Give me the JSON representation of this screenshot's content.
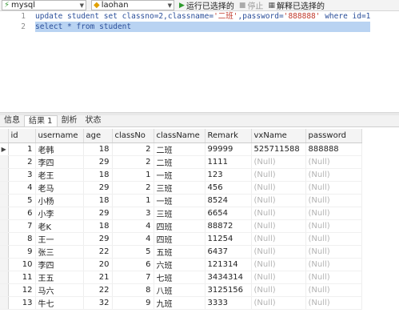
{
  "toolbar": {
    "connection": "mysql",
    "database": "laohan",
    "run_label": "运行已选择的",
    "stop_label": "停止",
    "explain_label": "解释已选择的"
  },
  "editor": {
    "lines": [
      {
        "number": "1",
        "pre": "update student set classno=2,classname=",
        "str1": "'二班'",
        "mid": ",password=",
        "str2": "'888888'",
        "post": " where id=1"
      },
      {
        "number": "2",
        "text": "select * from student"
      }
    ]
  },
  "tabs": [
    "信息",
    "结果 1",
    "剖析",
    "状态"
  ],
  "table": {
    "columns": [
      "id",
      "username",
      "age",
      "classNo",
      "className",
      "Remark",
      "vxName",
      "password"
    ],
    "rows": [
      [
        "1",
        "老韩",
        "18",
        "2",
        "二班",
        "99999",
        "525711588",
        "888888"
      ],
      [
        "2",
        "李四",
        "29",
        "2",
        "二班",
        "1111",
        "(Null)",
        "(Null)"
      ],
      [
        "3",
        "老王",
        "18",
        "1",
        "一班",
        "123",
        "(Null)",
        "(Null)"
      ],
      [
        "4",
        "老马",
        "29",
        "2",
        "三班",
        "456",
        "(Null)",
        "(Null)"
      ],
      [
        "5",
        "小杨",
        "18",
        "1",
        "一班",
        "8524",
        "(Null)",
        "(Null)"
      ],
      [
        "6",
        "小李",
        "29",
        "3",
        "三班",
        "6654",
        "(Null)",
        "(Null)"
      ],
      [
        "7",
        "老K",
        "18",
        "4",
        "四班",
        "88872",
        "(Null)",
        "(Null)"
      ],
      [
        "8",
        "王一",
        "29",
        "4",
        "四班",
        "11254",
        "(Null)",
        "(Null)"
      ],
      [
        "9",
        "张三",
        "22",
        "5",
        "五班",
        "6437",
        "(Null)",
        "(Null)"
      ],
      [
        "10",
        "李四",
        "20",
        "6",
        "六班",
        "121314",
        "(Null)",
        "(Null)"
      ],
      [
        "11",
        "王五",
        "21",
        "7",
        "七班",
        "3434314",
        "(Null)",
        "(Null)"
      ],
      [
        "12",
        "马六",
        "22",
        "8",
        "八班",
        "3125156",
        "(Null)",
        "(Null)"
      ],
      [
        "13",
        "牛七",
        "32",
        "9",
        "九班",
        "3333",
        "(Null)",
        "(Null)"
      ]
    ]
  }
}
